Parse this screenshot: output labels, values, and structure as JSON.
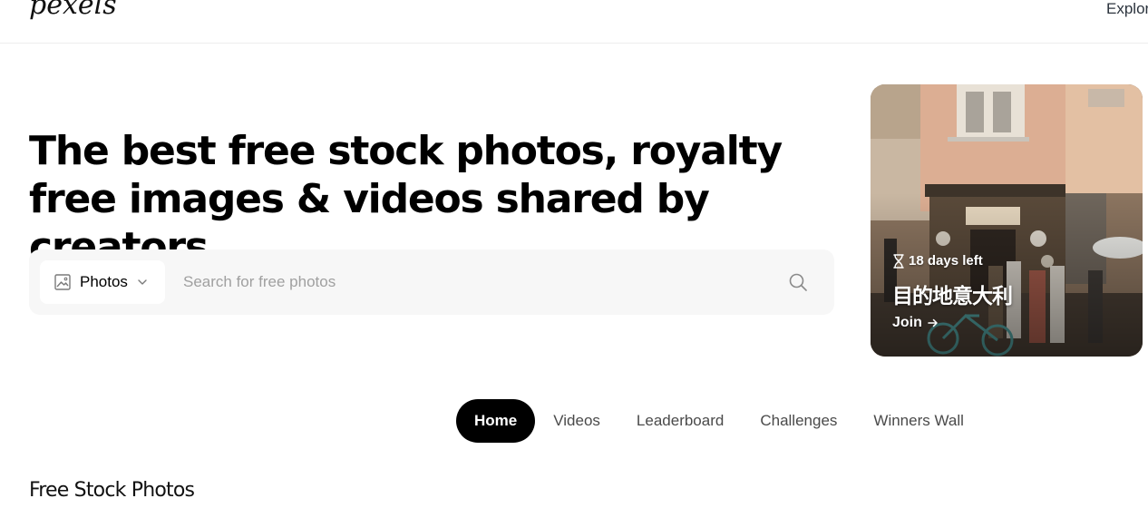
{
  "header": {
    "logo_text": "pexels",
    "nav_explore": "Explore"
  },
  "hero": {
    "title": "The best free stock photos, royalty free images & videos shared by creators."
  },
  "search": {
    "type_label": "Photos",
    "placeholder": "Search for free photos",
    "value": ""
  },
  "challenge_card": {
    "days_left": "18 days left",
    "title": "目的地意大利",
    "join_label": "Join"
  },
  "tabs": [
    {
      "label": "Home",
      "active": true
    },
    {
      "label": "Videos",
      "active": false
    },
    {
      "label": "Leaderboard",
      "active": false
    },
    {
      "label": "Challenges",
      "active": false
    },
    {
      "label": "Winners Wall",
      "active": false
    }
  ],
  "section": {
    "title": "Free Stock Photos"
  },
  "colors": {
    "accent": "#000000",
    "search_bg": "#f7f7f7",
    "text": "#2c343e"
  },
  "icons": {
    "type_icon": "image-icon",
    "dropdown": "chevron-down-icon",
    "search": "search-icon",
    "timer": "hourglass-icon",
    "join": "arrow-right-icon"
  }
}
